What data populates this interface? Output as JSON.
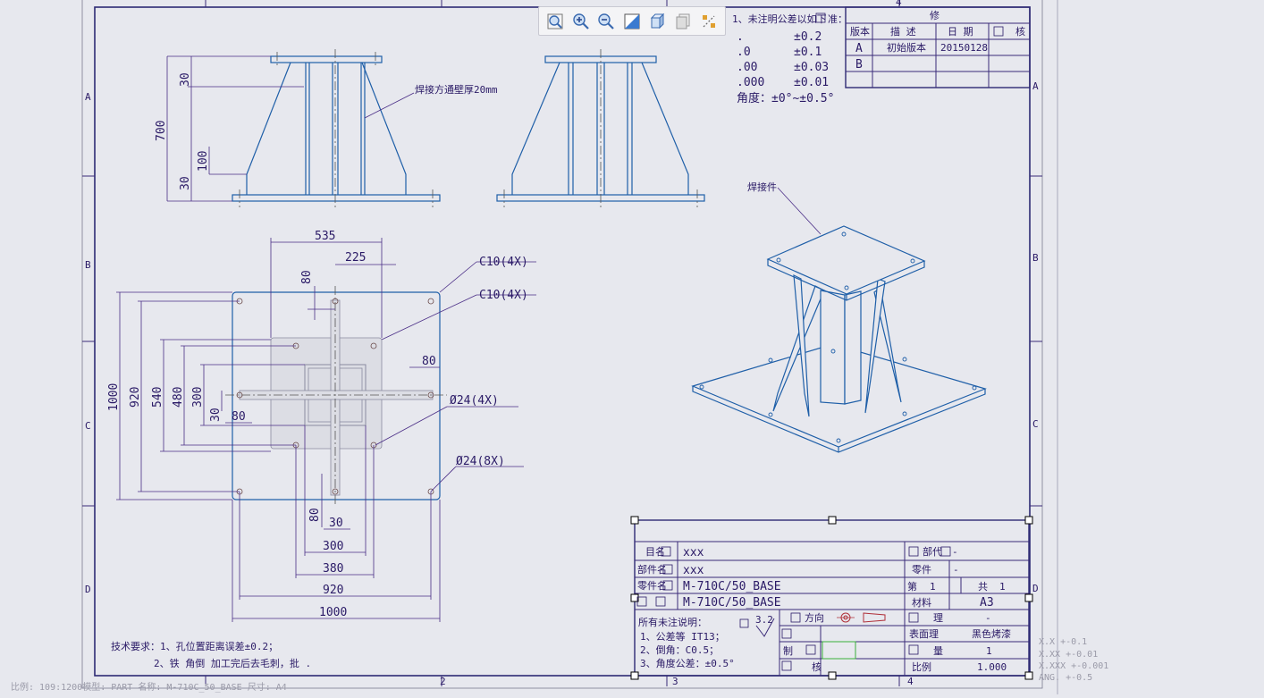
{
  "toolbar": {
    "tools": [
      "zoom-to-fit-icon",
      "zoom-in-icon",
      "zoom-out-icon",
      "shaded-view-icon",
      "3d-view-icon",
      "copy-view-icon",
      "explode-icon"
    ]
  },
  "notes": {
    "line1": "1、未注明公差以如下",
    "line1b": "准：",
    "rows": [
      {
        "k": ".",
        "v": "±0.2"
      },
      {
        "k": ".0",
        "v": "±0.1"
      },
      {
        "k": ".00",
        "v": "±0.03"
      },
      {
        "k": ".000",
        "v": "±0.01"
      }
    ],
    "angle": "角度：±0°~±0.5°"
  },
  "revision": {
    "title": "修",
    "headers": [
      "版本",
      "描 述",
      "日 期",
      "核"
    ],
    "rows": [
      {
        "ver": "A",
        "desc": "初始版本",
        "date": "20150128"
      },
      {
        "ver": "B",
        "desc": "",
        "date": ""
      }
    ]
  },
  "views": {
    "front": {
      "weld_note": "焊接方通壁厚20mm",
      "dims": [
        "30",
        "700",
        "100",
        "30"
      ]
    },
    "top": {
      "dims_top": [
        "535",
        "225",
        "80",
        "80"
      ],
      "dims_left": [
        "1000",
        "920",
        "540",
        "480",
        "300",
        "30",
        "80"
      ],
      "dims_bottom": [
        "80",
        "30",
        "300",
        "380",
        "920",
        "1000"
      ],
      "callouts": [
        "C10(4X)",
        "C10(4X)",
        "Ø24(4X)",
        "Ø24(8X)"
      ]
    },
    "iso": {
      "label": "焊接件"
    }
  },
  "tech_req": {
    "line1": "技术要求：1、孔位置距离误差±0.2；",
    "line2": "2、铁 角倒 加工完后去毛刺，批 ."
  },
  "title_block": {
    "project_label": "目名",
    "project_value": "xxx",
    "component_label": "部件名",
    "component_value": "xxx",
    "part_label": "零件名",
    "part_value": "M-710C/50_BASE",
    "drawing_value": "M-710C/50_BASE",
    "dept_label": "部代",
    "dept_value": "-",
    "part_no_label": "零件",
    "part_no_value": "-",
    "sheet_label": "第",
    "sheet_num": "1",
    "total_label": "共",
    "total_num": "1",
    "material_label": "材料",
    "material_value": "A3",
    "gen_notes_title": "所有未注说明：",
    "gen_notes": [
      "1、公差等 IT13；",
      "2、倒角：C0.5；",
      "3、角度公差：±0.5°"
    ],
    "roughness": "3.2",
    "view_label": "方向",
    "treat_label": "理",
    "treat_value": "-",
    "surface_label": "表面理",
    "surface_value": "黑色烤漆",
    "weight_label": "量",
    "weight_value": "1",
    "scale_label": "比例",
    "scale_value": "1.000",
    "draw_label": "制",
    "check_label": "核"
  },
  "tolerance_table": [
    "X.X    +-0.1",
    "X.XX   +-0.01",
    "X.XXX  +-0.001",
    "ANG.   +-0.5"
  ],
  "status_bar": "比例: 109:1200模型: PART  名称: M-710C_50_BASE  尺寸: A4",
  "zones": {
    "top": [
      "1",
      "2",
      "3",
      "4"
    ],
    "side": [
      "A",
      "B",
      "C",
      "D"
    ]
  }
}
